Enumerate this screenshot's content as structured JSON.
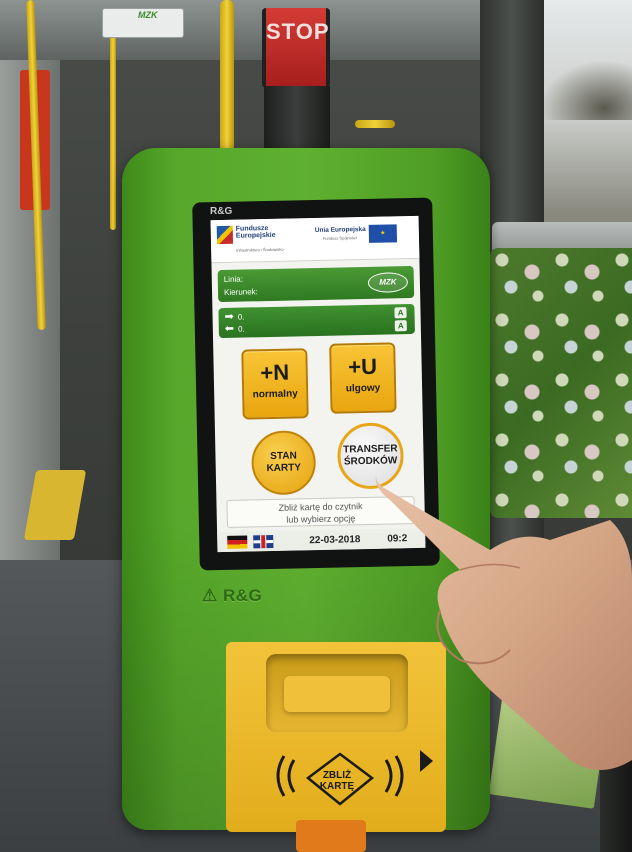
{
  "stop_button": {
    "label": "STOP"
  },
  "overhead_device": {
    "logo": "MZK"
  },
  "device": {
    "brand": "R&G",
    "screen_brand": "R&G"
  },
  "screen": {
    "eu_banner": {
      "left_title_line1": "Fundusze",
      "left_title_line2": "Europejskie",
      "left_subtitle": "Infrastruktura i Środowisko",
      "right_title": "Unia Europejska",
      "right_subtitle": "Fundusz Spójności"
    },
    "info": {
      "linia_label": "Linia:",
      "kierunek_label": "Kierunek:",
      "logo": "MZK"
    },
    "directions": [
      {
        "arrow": "right-arrow-icon",
        "value": "0.",
        "badge": "A"
      },
      {
        "arrow": "left-arrow-icon",
        "value": "0.",
        "badge": "A"
      }
    ],
    "tickets": {
      "normal": {
        "main": "+N",
        "sub": "normalny"
      },
      "reduced": {
        "main": "+U",
        "sub": "ulgowy"
      }
    },
    "card_status": {
      "line1": "STAN",
      "line2": "KARTY"
    },
    "transfer": {
      "line1": "TRANSFER",
      "line2": "ŚRODKÓW"
    },
    "message": {
      "line1": "Zbliż kartę do czytnik",
      "line2": "lub wybierz opcję"
    },
    "languages": [
      "german-flag-icon",
      "uk-flag-icon"
    ],
    "date": "22-03-2018",
    "time": "09:2"
  },
  "reader": {
    "label_line1": "ZBLIŻ",
    "label_line2": "KARTĘ"
  },
  "colors": {
    "device_green": "#5fb030",
    "button_yellow": "#f8c437",
    "screen_green": "#3f9230"
  }
}
